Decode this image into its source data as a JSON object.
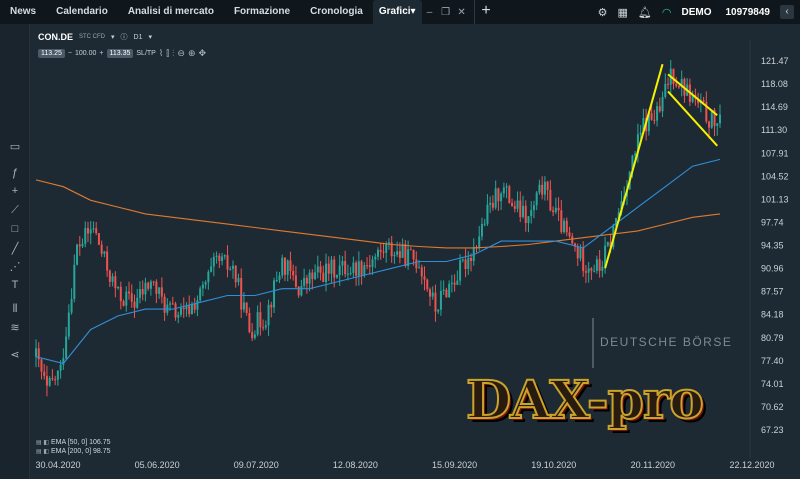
{
  "nav": {
    "tabs": [
      "News",
      "Calendario",
      "Analisi di mercato",
      "Formazione",
      "Cronologia"
    ],
    "active_tab": "Grafici",
    "active_caret": "▾",
    "add_label": "+",
    "minimize": "–",
    "restore": "❐",
    "close": "✕"
  },
  "account": {
    "type": "DEMO",
    "number": "10979849"
  },
  "icons": {
    "collapse": "chevron-left-icon",
    "settings": "gear-icon",
    "calculator": "calculator-icon",
    "bell": "bell-icon",
    "wifi": "wifi-icon"
  },
  "symbol": {
    "name": "CON.DE",
    "sub": "STC CFD",
    "caret": "▾",
    "timeframe": "D1",
    "tf_caret": "▾",
    "info": "ⓘ"
  },
  "prices": {
    "bid": "113.25",
    "spread_prefix": "−",
    "volume": "100.00",
    "spread_suffix": "+",
    "ask": "113.35",
    "sltp": "SL/TP"
  },
  "legend": [
    {
      "icon": "▤ ◧",
      "text": "EMA [50, 0] 106.75"
    },
    {
      "icon": "▤ ◧",
      "text": "EMA [200, 0] 98.75"
    }
  ],
  "watermarks": {
    "exchange": "DEUTSCHE BÖRSE",
    "logo": "DAX-pro"
  },
  "colors": {
    "up": "#26a69a",
    "down": "#ef5350",
    "ema50": "#2f8fd8",
    "ema200": "#e07a2f",
    "trend": "#f5f200",
    "bg": "#1e2a33"
  },
  "chart_data": {
    "type": "candlestick",
    "title": "CON.DE",
    "y_ticks": [
      121.47,
      118.08,
      114.69,
      111.3,
      107.91,
      104.52,
      101.13,
      97.74,
      94.35,
      90.96,
      87.57,
      84.18,
      80.79,
      77.4,
      74.01,
      70.62,
      67.23
    ],
    "x_ticks": [
      "30.04.2020",
      "05.06.2020",
      "09.07.2020",
      "12.08.2020",
      "15.09.2020",
      "19.10.2020",
      "20.11.2020",
      "22.12.2020"
    ],
    "ylim": [
      67.23,
      121.47
    ],
    "close_path": [
      [
        0,
        78
      ],
      [
        4,
        73
      ],
      [
        9,
        76
      ],
      [
        15,
        94
      ],
      [
        21,
        97
      ],
      [
        25,
        92
      ],
      [
        30,
        87
      ],
      [
        36,
        86
      ],
      [
        42,
        89
      ],
      [
        48,
        85
      ],
      [
        54,
        84
      ],
      [
        60,
        87
      ],
      [
        66,
        92
      ],
      [
        72,
        91
      ],
      [
        78,
        82
      ],
      [
        84,
        84
      ],
      [
        90,
        92
      ],
      [
        96,
        88
      ],
      [
        102,
        90
      ],
      [
        110,
        91
      ],
      [
        116,
        91
      ],
      [
        122,
        92
      ],
      [
        128,
        94
      ],
      [
        134,
        93
      ],
      [
        140,
        92
      ],
      [
        146,
        85
      ],
      [
        150,
        88
      ],
      [
        154,
        90
      ],
      [
        160,
        94
      ],
      [
        165,
        99
      ],
      [
        170,
        103
      ],
      [
        175,
        100
      ],
      [
        180,
        98
      ],
      [
        185,
        103
      ],
      [
        190,
        99
      ],
      [
        195,
        95
      ],
      [
        200,
        92
      ],
      [
        206,
        91
      ],
      [
        210,
        95
      ],
      [
        216,
        104
      ],
      [
        222,
        112
      ],
      [
        228,
        114
      ],
      [
        232,
        120
      ],
      [
        236,
        118
      ],
      [
        240,
        116
      ],
      [
        246,
        113
      ],
      [
        250,
        112
      ]
    ],
    "ema50": [
      [
        0,
        78
      ],
      [
        10,
        77
      ],
      [
        20,
        82
      ],
      [
        30,
        84
      ],
      [
        40,
        85
      ],
      [
        50,
        85
      ],
      [
        60,
        86
      ],
      [
        70,
        87
      ],
      [
        80,
        87
      ],
      [
        90,
        88
      ],
      [
        100,
        88
      ],
      [
        110,
        89
      ],
      [
        120,
        90
      ],
      [
        130,
        91
      ],
      [
        140,
        92
      ],
      [
        150,
        92
      ],
      [
        160,
        93
      ],
      [
        170,
        95
      ],
      [
        180,
        95
      ],
      [
        190,
        95
      ],
      [
        200,
        94
      ],
      [
        210,
        97
      ],
      [
        220,
        100
      ],
      [
        230,
        103
      ],
      [
        240,
        106
      ],
      [
        250,
        107
      ]
    ],
    "ema200": [
      [
        0,
        104
      ],
      [
        10,
        103
      ],
      [
        20,
        101
      ],
      [
        30,
        100
      ],
      [
        40,
        99
      ],
      [
        50,
        98.5
      ],
      [
        60,
        98
      ],
      [
        70,
        97.5
      ],
      [
        80,
        97
      ],
      [
        90,
        96.5
      ],
      [
        100,
        96
      ],
      [
        110,
        95.5
      ],
      [
        120,
        95
      ],
      [
        130,
        94.5
      ],
      [
        140,
        94.2
      ],
      [
        150,
        94
      ],
      [
        160,
        94
      ],
      [
        170,
        94.2
      ],
      [
        180,
        94.5
      ],
      [
        190,
        95
      ],
      [
        200,
        95.5
      ],
      [
        210,
        96
      ],
      [
        220,
        96.5
      ],
      [
        230,
        97.5
      ],
      [
        240,
        98.5
      ],
      [
        250,
        99
      ]
    ],
    "trendlines": [
      {
        "from": [
          208,
          91
        ],
        "to": [
          229,
          121
        ]
      },
      {
        "from": [
          231,
          119.5
        ],
        "to": [
          249,
          113.5
        ]
      },
      {
        "from": [
          231,
          117
        ],
        "to": [
          249,
          109
        ]
      }
    ],
    "n_bars": 251,
    "seed": 42
  }
}
